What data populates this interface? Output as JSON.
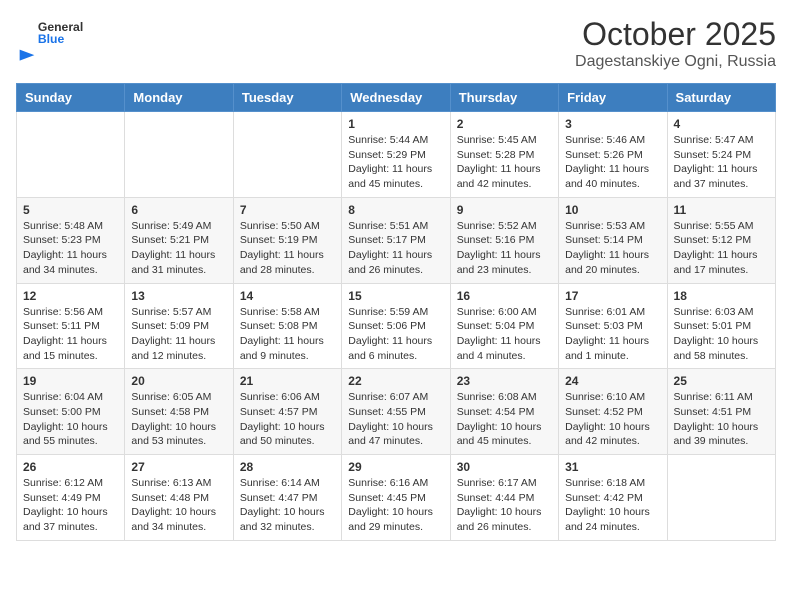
{
  "header": {
    "logo_general": "General",
    "logo_blue": "Blue",
    "title": "October 2025",
    "subtitle": "Dagestanskiye Ogni, Russia"
  },
  "days_of_week": [
    "Sunday",
    "Monday",
    "Tuesday",
    "Wednesday",
    "Thursday",
    "Friday",
    "Saturday"
  ],
  "weeks": [
    [
      {
        "day": "",
        "sunrise": "",
        "sunset": "",
        "daylight": ""
      },
      {
        "day": "",
        "sunrise": "",
        "sunset": "",
        "daylight": ""
      },
      {
        "day": "",
        "sunrise": "",
        "sunset": "",
        "daylight": ""
      },
      {
        "day": "1",
        "sunrise": "5:44 AM",
        "sunset": "5:29 PM",
        "daylight": "11 hours and 45 minutes."
      },
      {
        "day": "2",
        "sunrise": "5:45 AM",
        "sunset": "5:28 PM",
        "daylight": "11 hours and 42 minutes."
      },
      {
        "day": "3",
        "sunrise": "5:46 AM",
        "sunset": "5:26 PM",
        "daylight": "11 hours and 40 minutes."
      },
      {
        "day": "4",
        "sunrise": "5:47 AM",
        "sunset": "5:24 PM",
        "daylight": "11 hours and 37 minutes."
      }
    ],
    [
      {
        "day": "5",
        "sunrise": "5:48 AM",
        "sunset": "5:23 PM",
        "daylight": "11 hours and 34 minutes."
      },
      {
        "day": "6",
        "sunrise": "5:49 AM",
        "sunset": "5:21 PM",
        "daylight": "11 hours and 31 minutes."
      },
      {
        "day": "7",
        "sunrise": "5:50 AM",
        "sunset": "5:19 PM",
        "daylight": "11 hours and 28 minutes."
      },
      {
        "day": "8",
        "sunrise": "5:51 AM",
        "sunset": "5:17 PM",
        "daylight": "11 hours and 26 minutes."
      },
      {
        "day": "9",
        "sunrise": "5:52 AM",
        "sunset": "5:16 PM",
        "daylight": "11 hours and 23 minutes."
      },
      {
        "day": "10",
        "sunrise": "5:53 AM",
        "sunset": "5:14 PM",
        "daylight": "11 hours and 20 minutes."
      },
      {
        "day": "11",
        "sunrise": "5:55 AM",
        "sunset": "5:12 PM",
        "daylight": "11 hours and 17 minutes."
      }
    ],
    [
      {
        "day": "12",
        "sunrise": "5:56 AM",
        "sunset": "5:11 PM",
        "daylight": "11 hours and 15 minutes."
      },
      {
        "day": "13",
        "sunrise": "5:57 AM",
        "sunset": "5:09 PM",
        "daylight": "11 hours and 12 minutes."
      },
      {
        "day": "14",
        "sunrise": "5:58 AM",
        "sunset": "5:08 PM",
        "daylight": "11 hours and 9 minutes."
      },
      {
        "day": "15",
        "sunrise": "5:59 AM",
        "sunset": "5:06 PM",
        "daylight": "11 hours and 6 minutes."
      },
      {
        "day": "16",
        "sunrise": "6:00 AM",
        "sunset": "5:04 PM",
        "daylight": "11 hours and 4 minutes."
      },
      {
        "day": "17",
        "sunrise": "6:01 AM",
        "sunset": "5:03 PM",
        "daylight": "11 hours and 1 minute."
      },
      {
        "day": "18",
        "sunrise": "6:03 AM",
        "sunset": "5:01 PM",
        "daylight": "10 hours and 58 minutes."
      }
    ],
    [
      {
        "day": "19",
        "sunrise": "6:04 AM",
        "sunset": "5:00 PM",
        "daylight": "10 hours and 55 minutes."
      },
      {
        "day": "20",
        "sunrise": "6:05 AM",
        "sunset": "4:58 PM",
        "daylight": "10 hours and 53 minutes."
      },
      {
        "day": "21",
        "sunrise": "6:06 AM",
        "sunset": "4:57 PM",
        "daylight": "10 hours and 50 minutes."
      },
      {
        "day": "22",
        "sunrise": "6:07 AM",
        "sunset": "4:55 PM",
        "daylight": "10 hours and 47 minutes."
      },
      {
        "day": "23",
        "sunrise": "6:08 AM",
        "sunset": "4:54 PM",
        "daylight": "10 hours and 45 minutes."
      },
      {
        "day": "24",
        "sunrise": "6:10 AM",
        "sunset": "4:52 PM",
        "daylight": "10 hours and 42 minutes."
      },
      {
        "day": "25",
        "sunrise": "6:11 AM",
        "sunset": "4:51 PM",
        "daylight": "10 hours and 39 minutes."
      }
    ],
    [
      {
        "day": "26",
        "sunrise": "6:12 AM",
        "sunset": "4:49 PM",
        "daylight": "10 hours and 37 minutes."
      },
      {
        "day": "27",
        "sunrise": "6:13 AM",
        "sunset": "4:48 PM",
        "daylight": "10 hours and 34 minutes."
      },
      {
        "day": "28",
        "sunrise": "6:14 AM",
        "sunset": "4:47 PM",
        "daylight": "10 hours and 32 minutes."
      },
      {
        "day": "29",
        "sunrise": "6:16 AM",
        "sunset": "4:45 PM",
        "daylight": "10 hours and 29 minutes."
      },
      {
        "day": "30",
        "sunrise": "6:17 AM",
        "sunset": "4:44 PM",
        "daylight": "10 hours and 26 minutes."
      },
      {
        "day": "31",
        "sunrise": "6:18 AM",
        "sunset": "4:42 PM",
        "daylight": "10 hours and 24 minutes."
      },
      {
        "day": "",
        "sunrise": "",
        "sunset": "",
        "daylight": ""
      }
    ]
  ],
  "labels": {
    "sunrise": "Sunrise:",
    "sunset": "Sunset:",
    "daylight": "Daylight:"
  },
  "colors": {
    "header_bg": "#3d7ebf",
    "accent": "#1a73e8"
  }
}
